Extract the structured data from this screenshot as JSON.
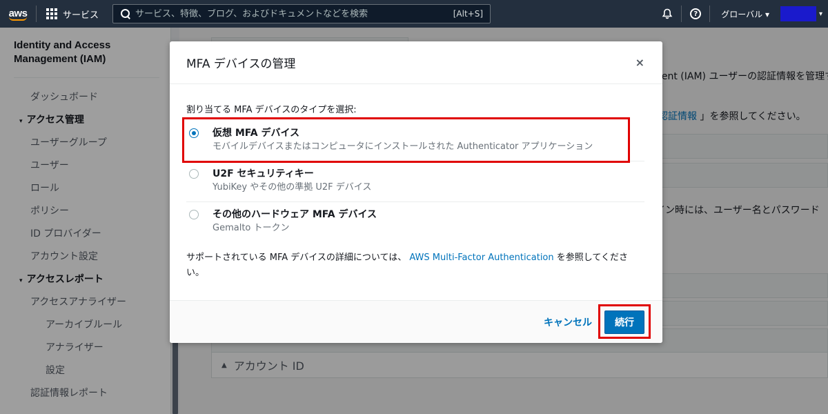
{
  "topnav": {
    "logo": "aws",
    "services_label": "サービス",
    "search_placeholder": "サービス、特徴、ブログ、およびドキュメントなどを検索",
    "search_shortcut": "[Alt+S]",
    "region_label": "グローバル ▾",
    "account_caret": "▾"
  },
  "sidebar": {
    "title": "Identity and Access\nManagement (IAM)",
    "items": [
      {
        "label": "ダッシュボード"
      },
      {
        "label": "アクセス管理",
        "caret": "▾"
      },
      {
        "label": "ユーザーグループ"
      },
      {
        "label": "ユーザー"
      },
      {
        "label": "ロール"
      },
      {
        "label": "ポリシー"
      },
      {
        "label": "ID プロバイダー"
      },
      {
        "label": "アカウント設定"
      },
      {
        "label": "アクセスレポート",
        "caret": "▾"
      },
      {
        "label": "アクセスアナライザー"
      },
      {
        "label": "アーカイブルール"
      },
      {
        "label": "アナライザー"
      },
      {
        "label": "設定"
      },
      {
        "label": "認証情報レポート"
      }
    ]
  },
  "background": {
    "line1": "nent (IAM) ユーザーの認証情報を管理す",
    "line2_link": "認証情報",
    "line2_rest": " 」を参照してください。",
    "line3": "イン時には、ユーザー名とパスワード",
    "account_id_caret": "▲",
    "account_id": "アカウント ID"
  },
  "modal": {
    "title": "MFA デバイスの管理",
    "close": "×",
    "select_label": "割り当てる MFA デバイスのタイプを選択:",
    "options": [
      {
        "title": "仮想 MFA デバイス",
        "desc": "モバイルデバイスまたはコンピュータにインストールされた Authenticator アプリケーション",
        "checked": true
      },
      {
        "title": "U2F セキュリティキー",
        "desc": "YubiKey やその他の準拠 U2F デバイス",
        "checked": false
      },
      {
        "title": "その他のハードウェア MFA デバイス",
        "desc": "Gemalto トークン",
        "checked": false
      }
    ],
    "help_prefix": "サポートされている MFA デバイスの詳細については、 ",
    "help_link": "AWS Multi-Factor Authentication",
    "help_suffix": " を参照してください。",
    "cancel": "キャンセル",
    "continue": "続行"
  },
  "colors": {
    "nav_bg": "#232f3e",
    "accent": "#0073bb",
    "highlight": "#e00000",
    "aws_orange": "#ff9900"
  }
}
